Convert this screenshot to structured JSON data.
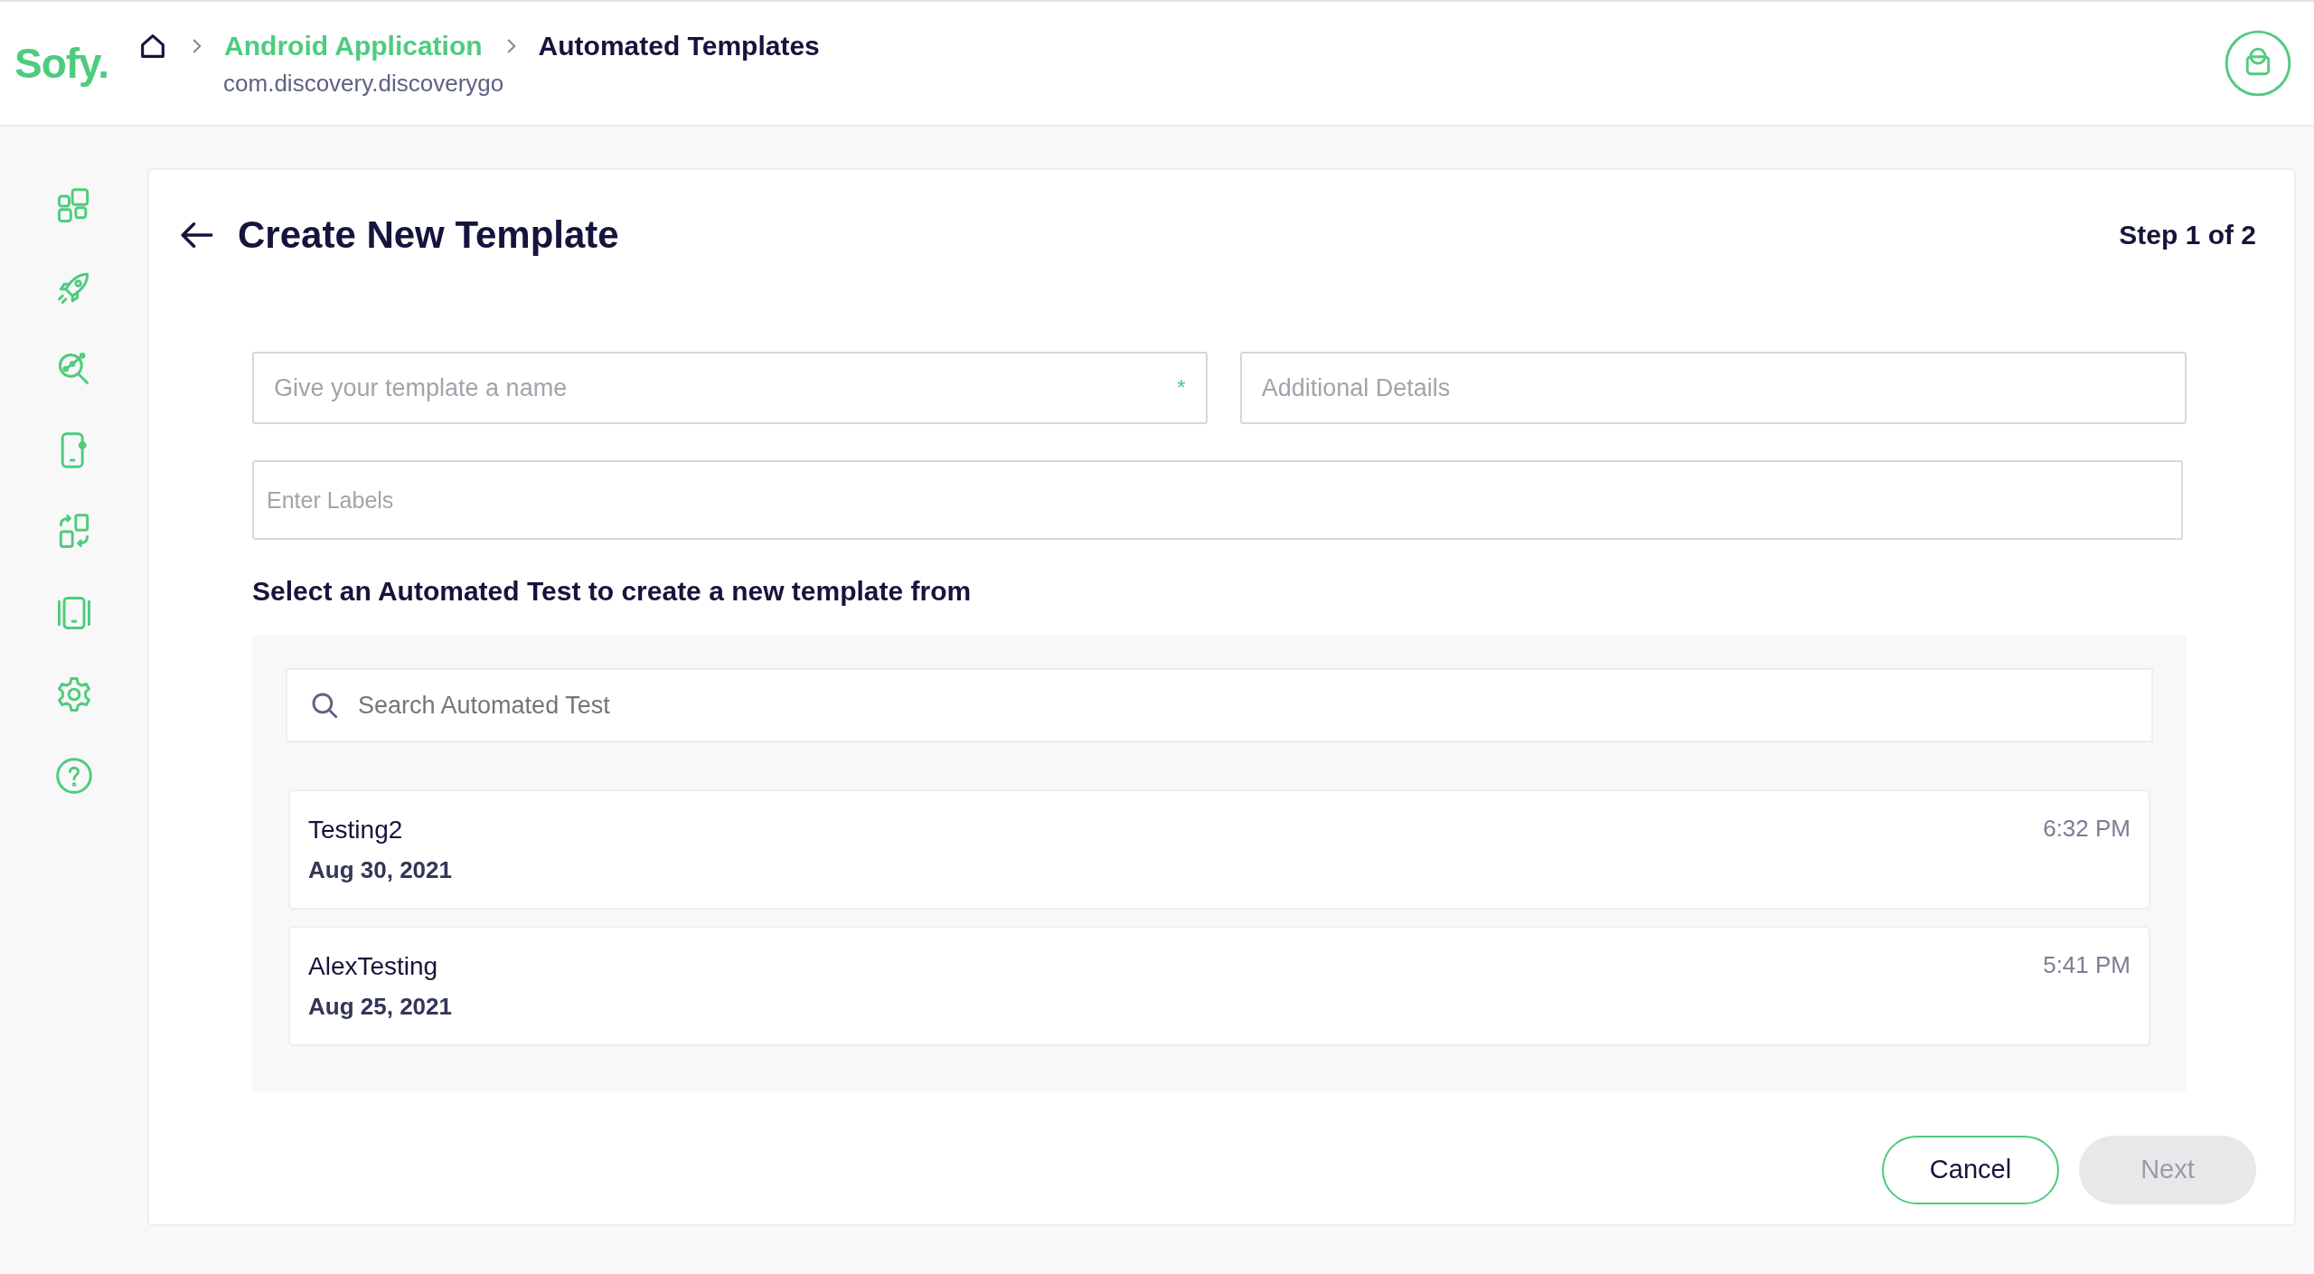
{
  "header": {
    "logo": "Sofy.",
    "breadcrumb": [
      {
        "label": "Android Application",
        "current": false
      },
      {
        "label": "Automated Templates",
        "current": true
      }
    ],
    "subtitle": "com.discovery.discoverygo"
  },
  "page": {
    "title": "Create New Template",
    "step": "Step 1 of 2"
  },
  "fields": [
    {
      "placeholder": "Give your template a name",
      "required_mark": "*"
    },
    {
      "placeholder": "Additional Details"
    }
  ],
  "labels_field": {
    "placeholder": "Enter Labels"
  },
  "section_heading": "Select an Automated Test to create a new template from",
  "search": {
    "placeholder": "Search Automated Test"
  },
  "tests": [
    {
      "name": "Testing2",
      "date": "Aug 30, 2021",
      "time": "6:32 PM"
    },
    {
      "name": "AlexTesting",
      "date": "Aug 25, 2021",
      "time": "5:41 PM"
    }
  ],
  "buttons": [
    {
      "label": "Cancel",
      "kind": "outline",
      "disabled": false
    },
    {
      "label": "Next",
      "kind": "primary",
      "disabled": true
    }
  ]
}
